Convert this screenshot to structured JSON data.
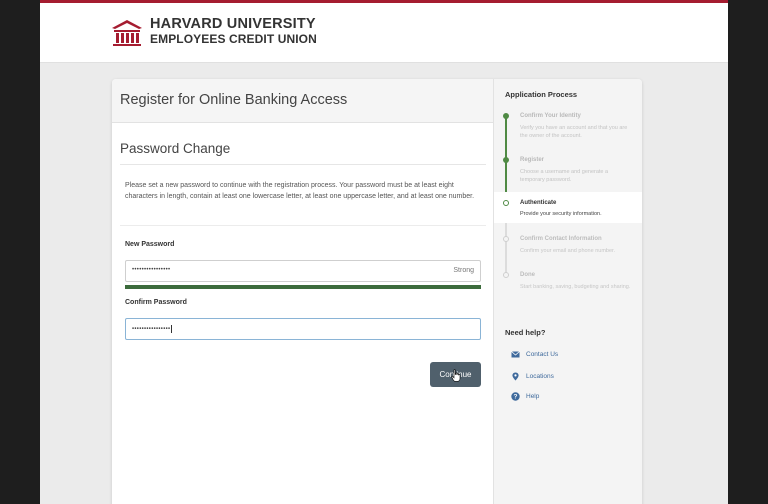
{
  "brand": {
    "line1": "HARVARD UNIVERSITY",
    "line2": "EMPLOYEES CREDIT UNION",
    "accent_color": "#a51c30"
  },
  "page": {
    "title": "Register for Online Banking Access",
    "section_title": "Password Change",
    "description": "Please set a new password to continue with the registration process. Your password must be at least eight characters in length, contain at least one lowercase letter, at least one uppercase letter, and at least one number."
  },
  "form": {
    "new_password": {
      "label": "New Password",
      "masked_value": "••••••••••••••••",
      "strength": "Strong",
      "strength_fraction": 1.0
    },
    "confirm_password": {
      "label": "Confirm Password",
      "masked_value": "••••••••••••••••"
    },
    "continue_label": "Continue"
  },
  "sidebar": {
    "title": "Application Process",
    "steps": [
      {
        "title": "Confirm Your Identity",
        "desc": "Verify you have an account and that you are the owner of the account.",
        "state": "done"
      },
      {
        "title": "Register",
        "desc": "Choose a username and generate a temporary password.",
        "state": "done"
      },
      {
        "title": "Authenticate",
        "desc": "Provide your security information.",
        "state": "active"
      },
      {
        "title": "Confirm Contact Information",
        "desc": "Confirm your email and phone number.",
        "state": "todo"
      },
      {
        "title": "Done",
        "desc": "Start banking, saving, budgeting and sharing.",
        "state": "todo"
      }
    ],
    "help_title": "Need help?",
    "help_items": [
      {
        "label": "Contact Us",
        "icon": "envelope-icon"
      },
      {
        "label": "Locations",
        "icon": "map-pin-icon"
      },
      {
        "label": "Help",
        "icon": "question-icon"
      }
    ]
  }
}
